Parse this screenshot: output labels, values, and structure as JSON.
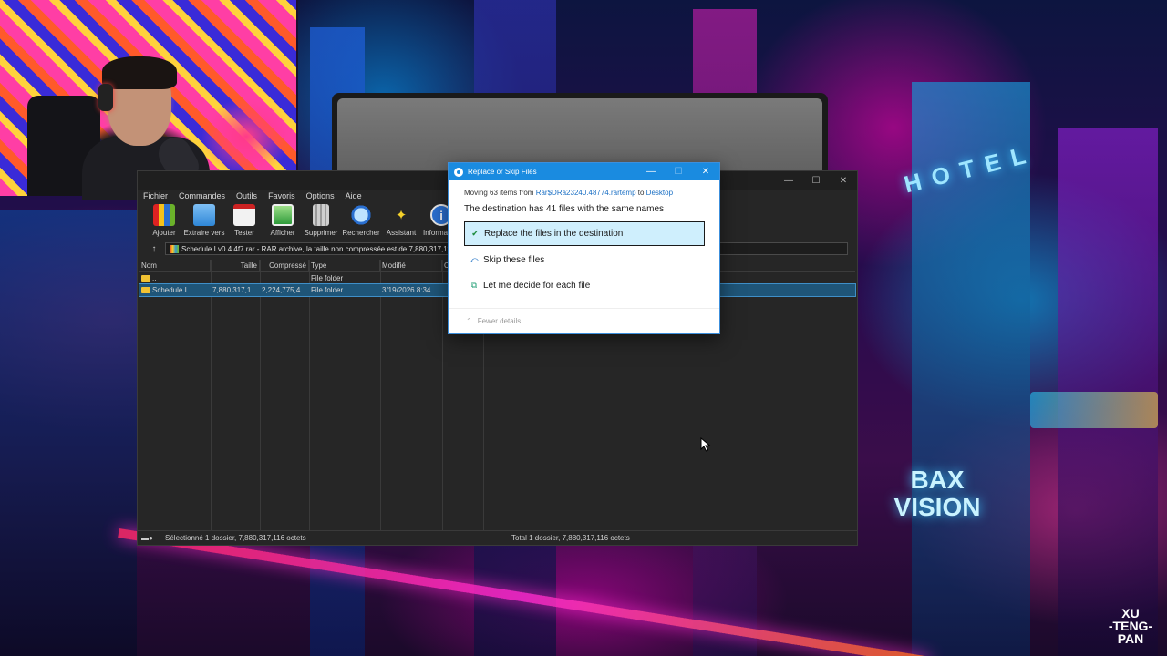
{
  "winrar": {
    "menu": [
      "Fichier",
      "Commandes",
      "Outils",
      "Favoris",
      "Options",
      "Aide"
    ],
    "toolbar": [
      {
        "label": "Ajouter",
        "icon": "books-add-icon"
      },
      {
        "label": "Extraire vers",
        "icon": "folder-extract-icon"
      },
      {
        "label": "Tester",
        "icon": "test-clipboard-icon"
      },
      {
        "label": "Afficher",
        "icon": "view-picture-icon"
      },
      {
        "label": "Supprimer",
        "icon": "trash-icon"
      },
      {
        "label": "Rechercher",
        "icon": "magnifier-icon"
      },
      {
        "label": "Assistant",
        "icon": "magic-wand-icon"
      },
      {
        "label": "Information",
        "icon": "info-icon"
      }
    ],
    "path_text": "Schedule I v0.4.4f7.rar - RAR archive, la taille non compressée est de 7,880,317,116",
    "columns": [
      "Nom",
      "Taille",
      "Compressé",
      "Type",
      "Modifié",
      "C"
    ],
    "rows": [
      {
        "name": "..",
        "size": "",
        "packed": "",
        "type": "File folder",
        "modified": ""
      },
      {
        "name": "Schedule I",
        "size": "7,880,317,1...",
        "packed": "2,224,775,4...",
        "type": "File folder",
        "modified": "3/19/2026 8:34..."
      }
    ],
    "status_left": "Sélectionné 1 dossier, 7,880,317,116 octets",
    "status_right": "Total 1 dossier, 7,880,317,116 octets"
  },
  "dialog": {
    "title": "Replace or Skip Files",
    "moving_prefix": "Moving 63 items from ",
    "moving_source": "Rar$DRa23240.48774.rartemp",
    "moving_mid": " to ",
    "moving_dest": "Desktop",
    "heading": "The destination has 41 files with the same names",
    "options": [
      {
        "label": "Replace the files in the destination",
        "icon": "checkmark-icon"
      },
      {
        "label": "Skip these files",
        "icon": "skip-arrow-icon"
      },
      {
        "label": "Let me decide for each file",
        "icon": "decide-files-icon"
      }
    ],
    "footer": "Fewer details"
  },
  "wallpaper": {
    "hotel_sign": "HOTEL",
    "bax_sign_line1": "BAX",
    "bax_sign_line2": "VISION",
    "logo_lines": [
      "XU",
      "-TENG-",
      "PAN"
    ]
  },
  "colors": {
    "accent": "#1a8be0",
    "selection": "#1f5578",
    "option_highlight": "#cfeffd",
    "winrar_bg": "#262626"
  }
}
